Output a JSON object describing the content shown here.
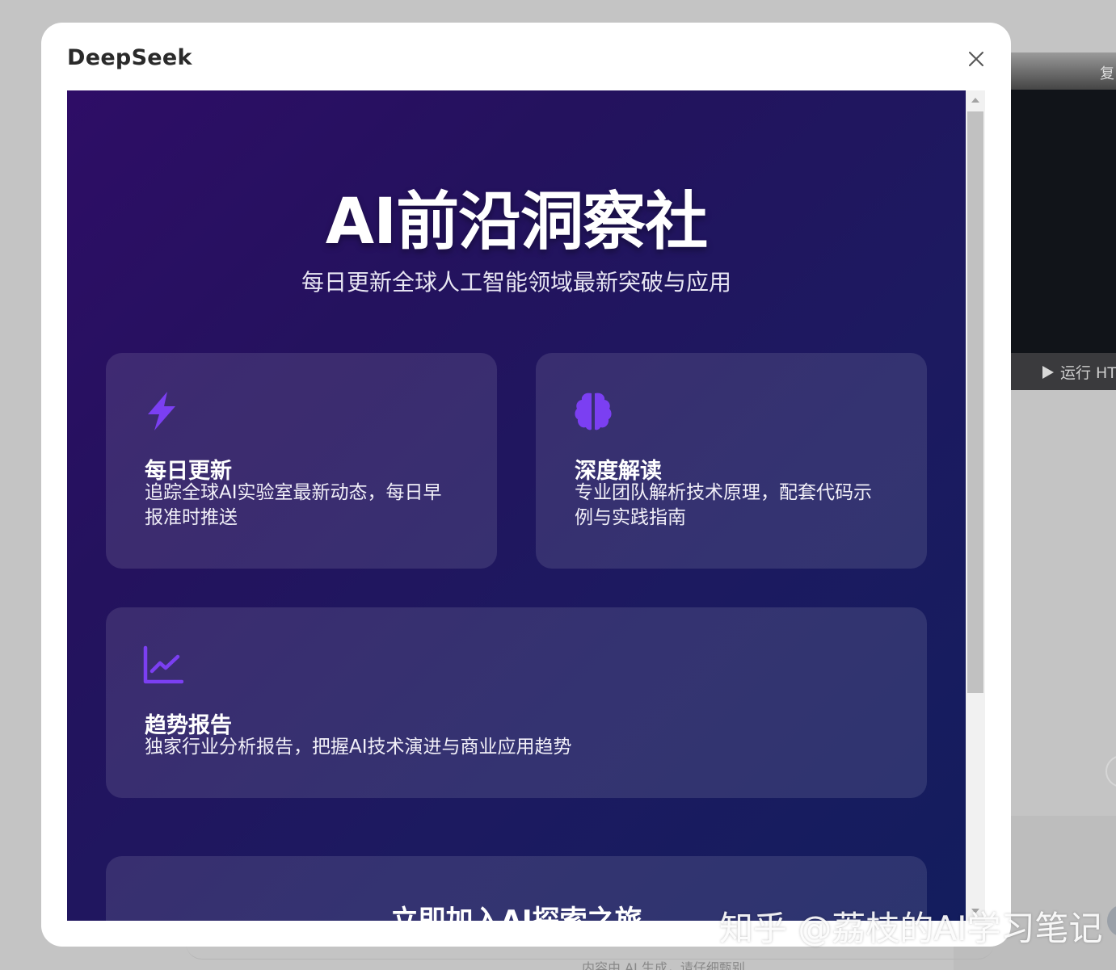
{
  "background": {
    "panel_top_char": "复",
    "run_button_label": "运行 HT",
    "footer_notice": "内容由 AI 生成，请仔细甄别"
  },
  "modal": {
    "title": "DeepSeek"
  },
  "page": {
    "hero_title": "AI前沿洞察社",
    "hero_subtitle": "每日更新全球人工智能领域最新突破与应用",
    "features": [
      {
        "icon": "lightning-icon",
        "title": "每日更新",
        "description": "追踪全球AI实验室最新动态，每日早报准时推送"
      },
      {
        "icon": "brain-icon",
        "title": "深度解读",
        "description": "专业团队解析技术原理，配套代码示例与实践指南"
      },
      {
        "icon": "chart-line-icon",
        "title": "趋势报告",
        "description": "独家行业分析报告，把握AI技术演进与商业应用趋势"
      }
    ],
    "cta_title": "立即加入AI探索之旅"
  },
  "watermark": "知乎 @荔枝的AI学习笔记",
  "colors": {
    "accent_icon": "#7b3ff2",
    "gradient_start": "#2e0d66",
    "gradient_end": "#131d5e"
  }
}
